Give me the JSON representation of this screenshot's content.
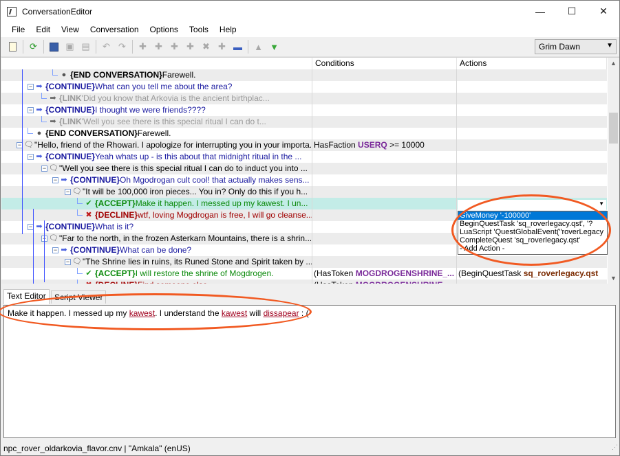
{
  "window": {
    "title": "ConversationEditor",
    "minimize": "—",
    "maximize": "☐",
    "close": "✕"
  },
  "menu": [
    "File",
    "Edit",
    "View",
    "Conversation",
    "Options",
    "Tools",
    "Help"
  ],
  "toolbar": {
    "game_select": "Grim Dawn",
    "icons": [
      "new-file-icon",
      "refresh-icon",
      "save-icon",
      "save-all-icon",
      "export-icon",
      "undo-icon",
      "redo-icon",
      "add-node-icon",
      "add-child-icon",
      "add-sibling-icon",
      "add-link-icon",
      "remove-icon",
      "minus-icon",
      "move-up-icon",
      "move-down-icon"
    ]
  },
  "grid": {
    "columns": [
      "",
      "Conditions",
      "Actions"
    ],
    "rows": [
      {
        "kind": "end",
        "kw": "{END CONVERSATION}",
        "text": "Farewell.",
        "cond": "",
        "act": ""
      },
      {
        "kind": "cont",
        "kw": "{CONTINUE}",
        "text": "What can you tell me about the area?",
        "cond": "",
        "act": ""
      },
      {
        "kind": "link",
        "kw": "{LINK",
        "text": "'Did you know that Arkovia is the ancient birthplac...",
        "cond": "",
        "act": ""
      },
      {
        "kind": "cont",
        "kw": "{CONTINUE}",
        "text": "I thought we were friends????",
        "cond": "",
        "act": ""
      },
      {
        "kind": "link",
        "kw": "{LINK",
        "text": "'Well you see there is this special ritual I can do t...",
        "cond": "",
        "act": ""
      },
      {
        "kind": "end",
        "kw": "{END CONVERSATION}",
        "text": "Farewell.",
        "cond": "",
        "act": ""
      },
      {
        "kind": "npc",
        "kw": "",
        "text": "\"Hello, friend of the Rhowari. I apologize for interrupting you in your importa...",
        "cond": "HasFaction",
        "cond_key": "USERQ",
        "cond_rest": " >= 10000",
        "act": ""
      },
      {
        "kind": "cont",
        "kw": "{CONTINUE}",
        "text": "Yeah whats up - is this about that midnight ritual in the ...",
        "cond": "",
        "act": ""
      },
      {
        "kind": "npc",
        "kw": "",
        "text": "\"Well you see there is this special ritual I can do to induct you into ...",
        "cond": "",
        "act": ""
      },
      {
        "kind": "cont",
        "kw": "{CONTINUE}",
        "text": "Oh Mgodrogan cult cool!  that actually makes sens...",
        "cond": "",
        "act": ""
      },
      {
        "kind": "npc",
        "kw": "",
        "text": "\"It will be 100,000 iron pieces... You in?  Only do this if you h...",
        "cond": "",
        "act": ""
      },
      {
        "kind": "accept",
        "kw": "{ACCEPT}",
        "text": "Make it happen.  I messed up my kawest.  I un...",
        "cond": "",
        "act": ""
      },
      {
        "kind": "decline",
        "kw": "{DECLINE}",
        "text": "wtf, loving Mogdrogan is free, I will go cleanse...",
        "cond": "",
        "act": ""
      },
      {
        "kind": "cont",
        "kw": "{CONTINUE}",
        "text": "What is it?",
        "cond": "",
        "act": ""
      },
      {
        "kind": "npc",
        "kw": "",
        "text": "\"Far to the north, in the frozen Asterkarn Mountains, there is a shrin...",
        "cond": "",
        "act": ""
      },
      {
        "kind": "cont",
        "kw": "{CONTINUE}",
        "text": "What can be done?",
        "cond": "",
        "act": ""
      },
      {
        "kind": "npc",
        "kw": "",
        "text": "\"The Shrine lies in ruins, its Runed Stone and Spirit taken by ...",
        "cond": "",
        "act": ""
      },
      {
        "kind": "accept",
        "kw": "{ACCEPT}",
        "text": "I will restore the shrine of Mogdrogen.",
        "cond": "(HasToken",
        "cond_key": "MOGDROGENSHRINE_...",
        "cond_rest": "",
        "act": "(BeginQuestTask",
        "act_key": "sq_roverlegacy.qst"
      },
      {
        "kind": "decline",
        "kw": "{DECLINE}",
        "text": "Find someone else.",
        "cond": "(HasToken",
        "cond_key": "MOGDROGENSHRINE_",
        "cond_rest": "",
        "act": ""
      }
    ]
  },
  "actions_dropdown": {
    "current": "GiveMoney '-100000'",
    "items": [
      "GiveMoney '-100000'",
      "BeginQuestTask 'sq_roverlegacy.qst', '?",
      "LuaScript 'QuestGlobalEvent(\"roverLegacy",
      "CompleteQuest 'sq_roverlegacy.qst'",
      "- Add Action -"
    ]
  },
  "tabs": [
    "Text Editor",
    "Script Viewer"
  ],
  "editor": {
    "parts": [
      {
        "t": "Make it happen.  I messed up my ",
        "err": false
      },
      {
        "t": "kawest",
        "err": true
      },
      {
        "t": ".  I understand the ",
        "err": false
      },
      {
        "t": "kawest",
        "err": true
      },
      {
        "t": " will ",
        "err": false
      },
      {
        "t": "dissapear",
        "err": true
      },
      {
        "t": " : (",
        "err": false
      }
    ]
  },
  "status": "npc_rover_oldarkovia_flavor.cnv | \"Amkala\" (enUS)"
}
